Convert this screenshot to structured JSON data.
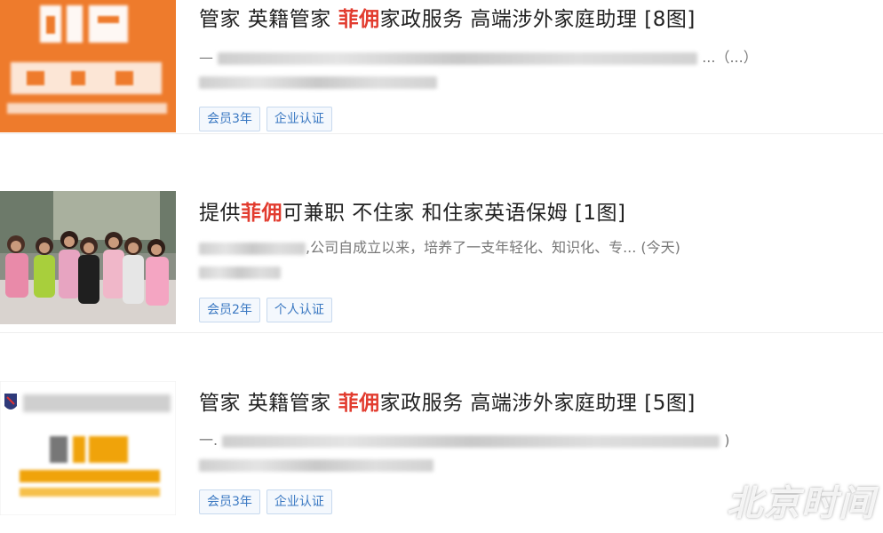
{
  "listings": [
    {
      "title_before": "管家 英籍管家 ",
      "title_highlight": "菲佣",
      "title_after": "家政服务 高端涉外家庭助理 [8图]",
      "desc_visible": "—",
      "desc_tail": "...（...）",
      "tags": [
        "会员3年",
        "企业认证"
      ]
    },
    {
      "title_before": "提供",
      "title_highlight": "菲佣",
      "title_after": "可兼职 不住家 和住家英语保姆 [1图]",
      "desc_visible": ",公司自成立以来，培养了一支年轻化、知识化、专... (今天)",
      "desc_tail": "",
      "tags": [
        "会员2年",
        "个人认证"
      ]
    },
    {
      "title_before": "管家 英籍管家 ",
      "title_highlight": "菲佣",
      "title_after": "家政服务 高端涉外家庭助理 [5图]",
      "desc_visible": "一.",
      "desc_tail": ")",
      "tags": [
        "会员3年",
        "企业认证"
      ]
    }
  ],
  "watermark": "北京时间",
  "colors": {
    "highlight": "#e23c2f",
    "tag_text": "#3a78c2",
    "logo_orange": "#ee7b2c"
  }
}
